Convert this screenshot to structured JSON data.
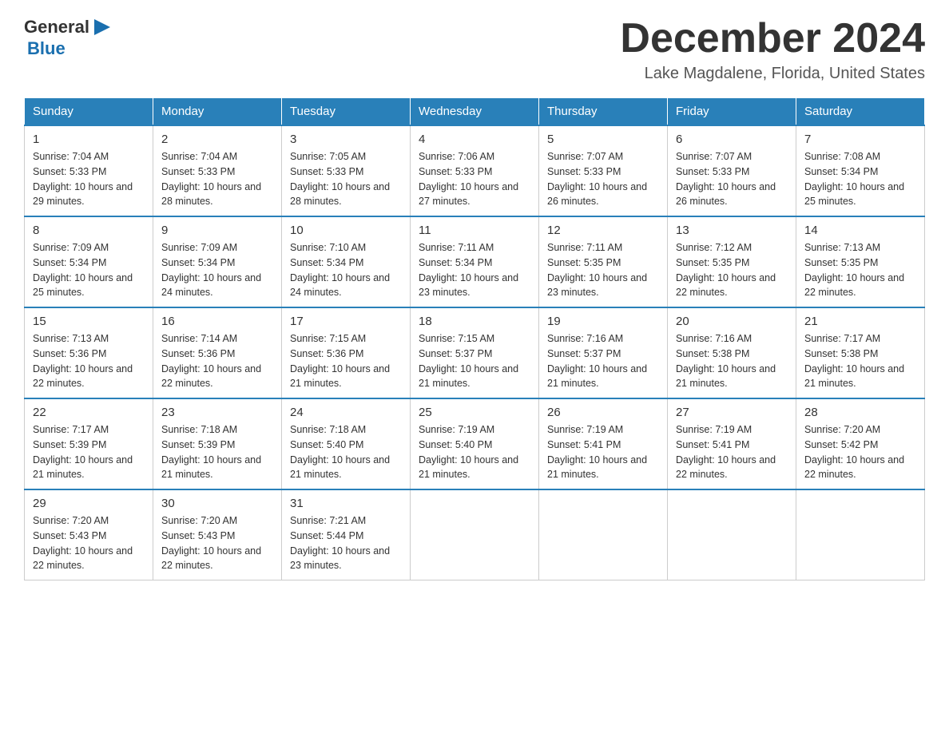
{
  "header": {
    "logo_general": "General",
    "logo_blue": "Blue",
    "month": "December 2024",
    "location": "Lake Magdalene, Florida, United States"
  },
  "days_of_week": [
    "Sunday",
    "Monday",
    "Tuesday",
    "Wednesday",
    "Thursday",
    "Friday",
    "Saturday"
  ],
  "weeks": [
    [
      {
        "day": "1",
        "sunrise": "7:04 AM",
        "sunset": "5:33 PM",
        "daylight": "10 hours and 29 minutes."
      },
      {
        "day": "2",
        "sunrise": "7:04 AM",
        "sunset": "5:33 PM",
        "daylight": "10 hours and 28 minutes."
      },
      {
        "day": "3",
        "sunrise": "7:05 AM",
        "sunset": "5:33 PM",
        "daylight": "10 hours and 28 minutes."
      },
      {
        "day": "4",
        "sunrise": "7:06 AM",
        "sunset": "5:33 PM",
        "daylight": "10 hours and 27 minutes."
      },
      {
        "day": "5",
        "sunrise": "7:07 AM",
        "sunset": "5:33 PM",
        "daylight": "10 hours and 26 minutes."
      },
      {
        "day": "6",
        "sunrise": "7:07 AM",
        "sunset": "5:33 PM",
        "daylight": "10 hours and 26 minutes."
      },
      {
        "day": "7",
        "sunrise": "7:08 AM",
        "sunset": "5:34 PM",
        "daylight": "10 hours and 25 minutes."
      }
    ],
    [
      {
        "day": "8",
        "sunrise": "7:09 AM",
        "sunset": "5:34 PM",
        "daylight": "10 hours and 25 minutes."
      },
      {
        "day": "9",
        "sunrise": "7:09 AM",
        "sunset": "5:34 PM",
        "daylight": "10 hours and 24 minutes."
      },
      {
        "day": "10",
        "sunrise": "7:10 AM",
        "sunset": "5:34 PM",
        "daylight": "10 hours and 24 minutes."
      },
      {
        "day": "11",
        "sunrise": "7:11 AM",
        "sunset": "5:34 PM",
        "daylight": "10 hours and 23 minutes."
      },
      {
        "day": "12",
        "sunrise": "7:11 AM",
        "sunset": "5:35 PM",
        "daylight": "10 hours and 23 minutes."
      },
      {
        "day": "13",
        "sunrise": "7:12 AM",
        "sunset": "5:35 PM",
        "daylight": "10 hours and 22 minutes."
      },
      {
        "day": "14",
        "sunrise": "7:13 AM",
        "sunset": "5:35 PM",
        "daylight": "10 hours and 22 minutes."
      }
    ],
    [
      {
        "day": "15",
        "sunrise": "7:13 AM",
        "sunset": "5:36 PM",
        "daylight": "10 hours and 22 minutes."
      },
      {
        "day": "16",
        "sunrise": "7:14 AM",
        "sunset": "5:36 PM",
        "daylight": "10 hours and 22 minutes."
      },
      {
        "day": "17",
        "sunrise": "7:15 AM",
        "sunset": "5:36 PM",
        "daylight": "10 hours and 21 minutes."
      },
      {
        "day": "18",
        "sunrise": "7:15 AM",
        "sunset": "5:37 PM",
        "daylight": "10 hours and 21 minutes."
      },
      {
        "day": "19",
        "sunrise": "7:16 AM",
        "sunset": "5:37 PM",
        "daylight": "10 hours and 21 minutes."
      },
      {
        "day": "20",
        "sunrise": "7:16 AM",
        "sunset": "5:38 PM",
        "daylight": "10 hours and 21 minutes."
      },
      {
        "day": "21",
        "sunrise": "7:17 AM",
        "sunset": "5:38 PM",
        "daylight": "10 hours and 21 minutes."
      }
    ],
    [
      {
        "day": "22",
        "sunrise": "7:17 AM",
        "sunset": "5:39 PM",
        "daylight": "10 hours and 21 minutes."
      },
      {
        "day": "23",
        "sunrise": "7:18 AM",
        "sunset": "5:39 PM",
        "daylight": "10 hours and 21 minutes."
      },
      {
        "day": "24",
        "sunrise": "7:18 AM",
        "sunset": "5:40 PM",
        "daylight": "10 hours and 21 minutes."
      },
      {
        "day": "25",
        "sunrise": "7:19 AM",
        "sunset": "5:40 PM",
        "daylight": "10 hours and 21 minutes."
      },
      {
        "day": "26",
        "sunrise": "7:19 AM",
        "sunset": "5:41 PM",
        "daylight": "10 hours and 21 minutes."
      },
      {
        "day": "27",
        "sunrise": "7:19 AM",
        "sunset": "5:41 PM",
        "daylight": "10 hours and 22 minutes."
      },
      {
        "day": "28",
        "sunrise": "7:20 AM",
        "sunset": "5:42 PM",
        "daylight": "10 hours and 22 minutes."
      }
    ],
    [
      {
        "day": "29",
        "sunrise": "7:20 AM",
        "sunset": "5:43 PM",
        "daylight": "10 hours and 22 minutes."
      },
      {
        "day": "30",
        "sunrise": "7:20 AM",
        "sunset": "5:43 PM",
        "daylight": "10 hours and 22 minutes."
      },
      {
        "day": "31",
        "sunrise": "7:21 AM",
        "sunset": "5:44 PM",
        "daylight": "10 hours and 23 minutes."
      },
      null,
      null,
      null,
      null
    ]
  ]
}
